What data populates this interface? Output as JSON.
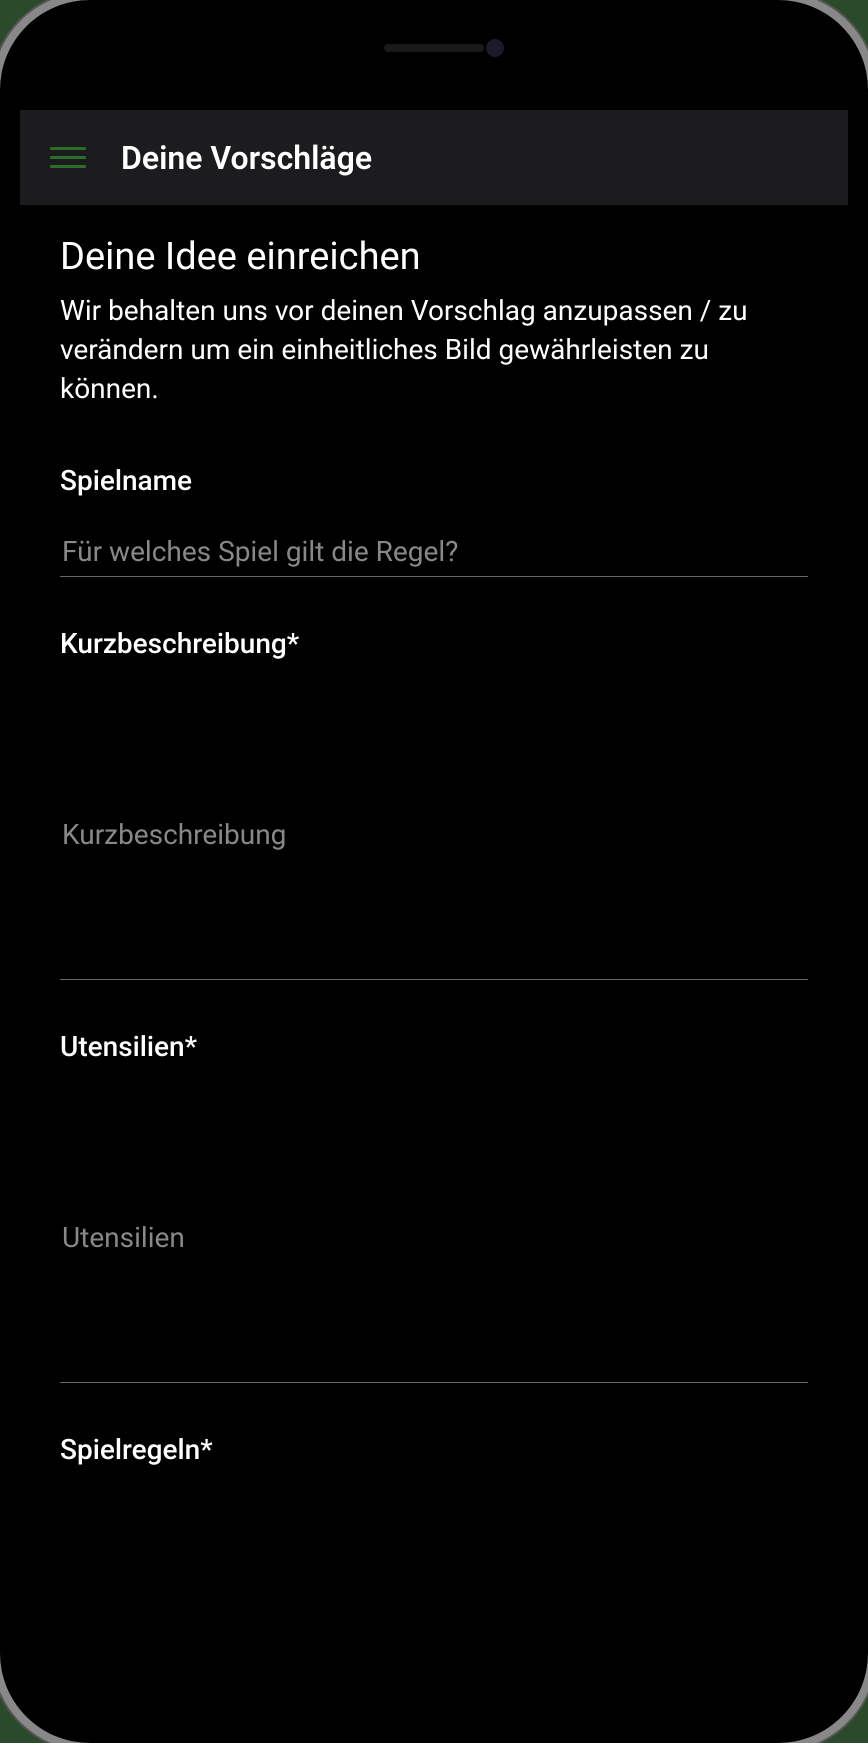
{
  "header": {
    "title": "Deine Vorschläge"
  },
  "page": {
    "title": "Deine Idee einreichen",
    "description": "Wir behalten uns vor deinen Vorschlag anzupassen / zu verändern um ein einheitliches Bild gewährleisten zu können."
  },
  "form": {
    "spielname": {
      "label": "Spielname",
      "placeholder": "Für welches Spiel gilt die Regel?",
      "value": ""
    },
    "kurzbeschreibung": {
      "label": "Kurzbeschreibung*",
      "placeholder": "Kurzbeschreibung",
      "value": ""
    },
    "utensilien": {
      "label": "Utensilien*",
      "placeholder": "Utensilien",
      "value": ""
    },
    "spielregeln": {
      "label": "Spielregeln*",
      "placeholder": "",
      "value": ""
    }
  }
}
